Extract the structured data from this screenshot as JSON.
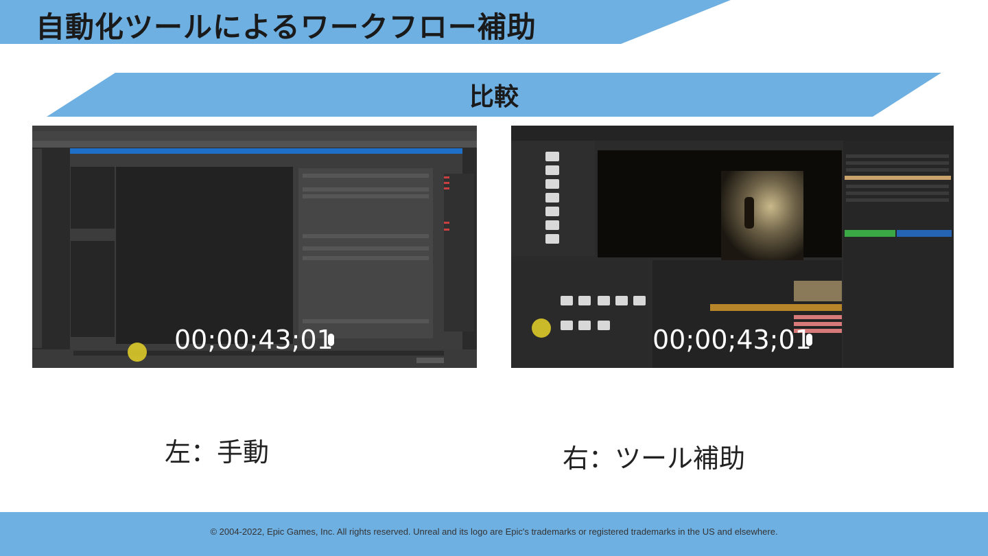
{
  "slide": {
    "title": "自動化ツールによるワークフロー補助",
    "subtitle": "比較",
    "captions": {
      "left": "左：手動",
      "right": "右：ツール補助"
    },
    "footer": "© 2004-2022, Epic Games, Inc. All rights reserved.  Unreal and its logo are Epic's trademarks or registered trademarks in the US and elsewhere."
  },
  "screenshots": {
    "left": {
      "timecode": "00;00;43;01"
    },
    "right": {
      "timecode": "00;00;43;01"
    }
  },
  "colors": {
    "band": "#6fb0e2",
    "cursor_highlight": "#e6d228"
  }
}
